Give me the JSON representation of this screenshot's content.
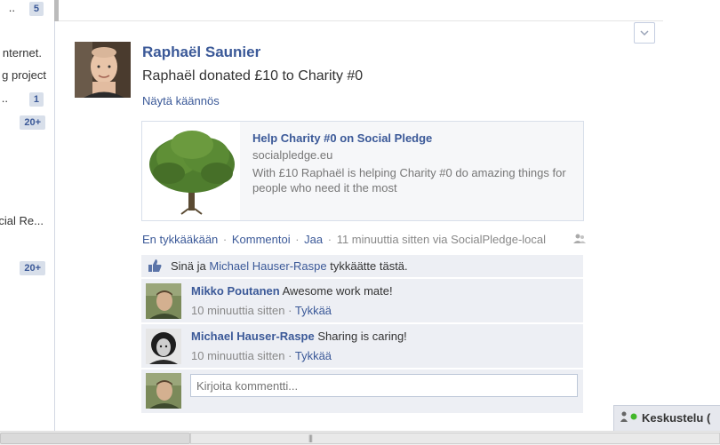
{
  "left_column": {
    "rows": [
      {
        "text": "..",
        "badge": "5"
      },
      {
        "text": "nternet."
      },
      {
        "text": "g project"
      },
      {
        "text": "..",
        "badge": "1"
      },
      {
        "badge": "20+"
      },
      {
        "text": "cial Re..."
      },
      {
        "badge": "20+"
      }
    ]
  },
  "story": {
    "author": "Raphaël Saunier",
    "message": "Raphaël donated £10 to Charity #0",
    "translate_link": "Näytä käännös",
    "attachment": {
      "title": "Help Charity #0 on Social Pledge",
      "domain": "socialpledge.eu",
      "description": "With £10 Raphaël is helping Charity #0 do amazing things for people who need it the most"
    },
    "actions": {
      "unlike": "En tykkääkään",
      "comment": "Kommentoi",
      "share": "Jaa",
      "time": "11 minuuttia sitten via SocialPledge-local"
    }
  },
  "likes": {
    "prefix": "Sinä ja ",
    "name": "Michael Hauser-Raspe",
    "suffix": " tykkäätte tästä."
  },
  "comments": [
    {
      "name": "Mikko Poutanen",
      "text": "Awesome work mate!",
      "time": "10 minuuttia sitten",
      "like": "Tykkää"
    },
    {
      "name": "Michael Hauser-Raspe",
      "text": "Sharing is caring!",
      "time": "10 minuuttia sitten",
      "like": "Tykkää"
    }
  ],
  "composer": {
    "placeholder": "Kirjoita kommentti..."
  },
  "chat": {
    "label": "Keskustelu ("
  },
  "colors": {
    "link": "#3b5998",
    "ufi_bg": "#edeff4",
    "online": "#42b72a"
  }
}
